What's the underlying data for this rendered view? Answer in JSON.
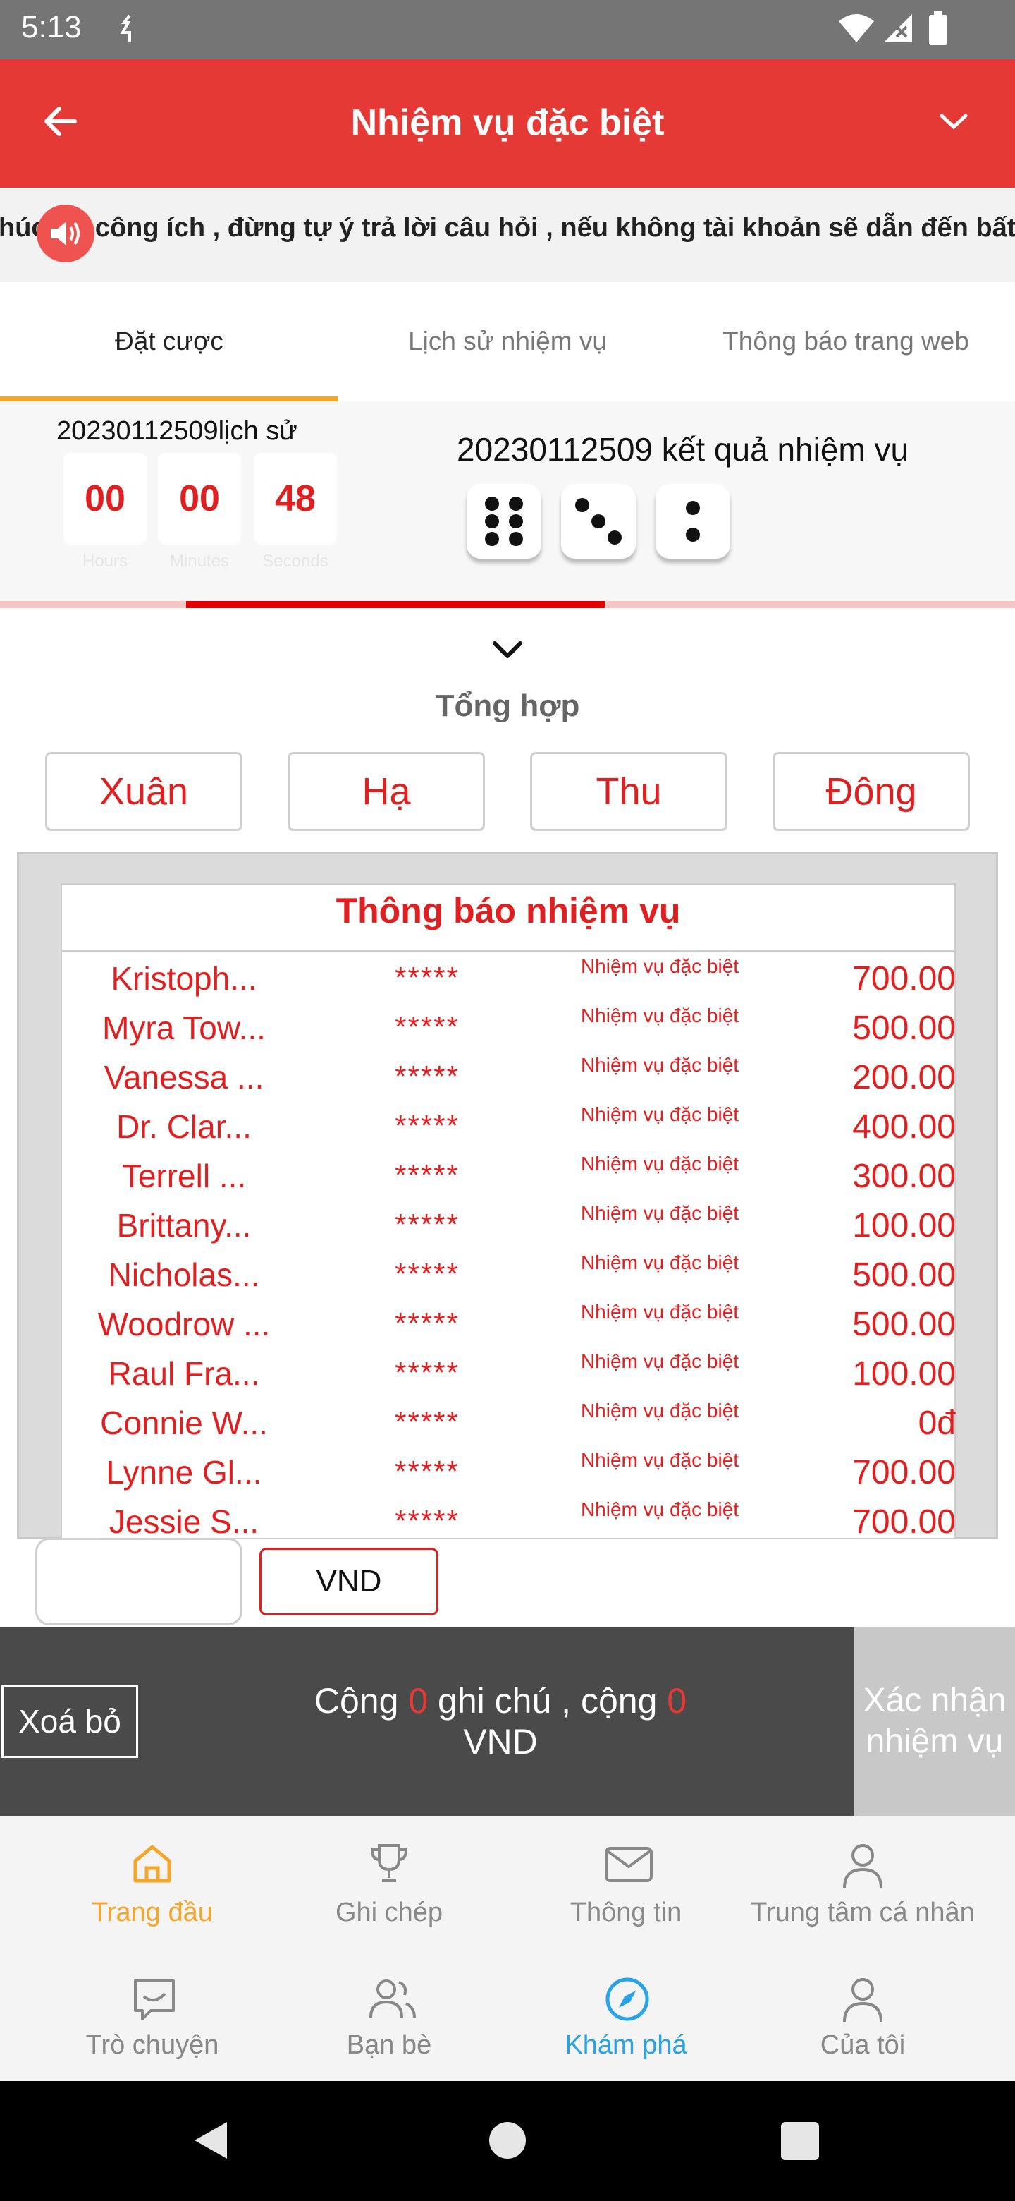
{
  "status_bar": {
    "time": "5:13"
  },
  "header": {
    "title": "Nhiệm vụ đặc biệt"
  },
  "marquee": {
    "text": "húc lời công ích , đừng tự ý trả lời câu hỏi , nếu không tài khoản sẽ dẫn đến bất"
  },
  "tabs": [
    {
      "label": "Đặt cược",
      "active": true
    },
    {
      "label": "Lịch sử nhiệm vụ",
      "active": false
    },
    {
      "label": "Thông báo trang web",
      "active": false
    }
  ],
  "round": {
    "issue_label": "20230112509lịch sử",
    "countdown": {
      "hours": "00",
      "minutes": "00",
      "seconds": "48",
      "hours_label": "Hours",
      "minutes_label": "Minutes",
      "seconds_label": "Seconds"
    },
    "result_label": "20230112509 kết quả nhiệm vụ",
    "dice": [
      6,
      3,
      2
    ],
    "progress": 0.41
  },
  "summary": {
    "label": "Tổng hợp"
  },
  "seasons": [
    "Xuân",
    "Hạ",
    "Thu",
    "Đông"
  ],
  "notice": {
    "title": "Thông báo nhiệm vụ",
    "rows": [
      {
        "name": "Kristoph...",
        "stars": "*****",
        "task": "Nhiệm vụ đặc biệt",
        "amount": "700.00"
      },
      {
        "name": "Myra Tow...",
        "stars": "*****",
        "task": "Nhiệm vụ đặc biệt",
        "amount": "500.00"
      },
      {
        "name": "Vanessa ...",
        "stars": "*****",
        "task": "Nhiệm vụ đặc biệt",
        "amount": "200.00"
      },
      {
        "name": "Dr. Clar...",
        "stars": "*****",
        "task": "Nhiệm vụ đặc biệt",
        "amount": "400.00"
      },
      {
        "name": "Terrell ...",
        "stars": "*****",
        "task": "Nhiệm vụ đặc biệt",
        "amount": "300.00"
      },
      {
        "name": "Brittany...",
        "stars": "*****",
        "task": "Nhiệm vụ đặc biệt",
        "amount": "100.00"
      },
      {
        "name": "Nicholas...",
        "stars": "*****",
        "task": "Nhiệm vụ đặc biệt",
        "amount": "500.00"
      },
      {
        "name": "Woodrow ...",
        "stars": "*****",
        "task": "Nhiệm vụ đặc biệt",
        "amount": "500.00"
      },
      {
        "name": "Raul Fra...",
        "stars": "*****",
        "task": "Nhiệm vụ đặc biệt",
        "amount": "100.00"
      },
      {
        "name": "Connie W...",
        "stars": "*****",
        "task": "Nhiệm vụ đặc biệt",
        "amount": "0đ"
      },
      {
        "name": "Lynne Gl...",
        "stars": "*****",
        "task": "Nhiệm vụ đặc biệt",
        "amount": "700.00"
      },
      {
        "name": "Jessie S...",
        "stars": "*****",
        "task": "Nhiệm vụ đặc biệt",
        "amount": "700.00"
      }
    ]
  },
  "entry": {
    "value": "",
    "currency_button": "VND"
  },
  "action_bar": {
    "clear_label": "Xoá bỏ",
    "totals_prefix": "Cộng",
    "notes_count": "0",
    "totals_mid": "ghi chú , cộng",
    "amount_total": "0",
    "currency": "VND",
    "confirm_label": "Xác nhận nhiệm vụ"
  },
  "inner_nav": [
    {
      "label": "Trang đầu",
      "icon": "home-icon",
      "active": true
    },
    {
      "label": "Ghi chép",
      "icon": "trophy-icon",
      "active": false
    },
    {
      "label": "Thông tin",
      "icon": "mail-icon",
      "active": false
    },
    {
      "label": "Trung tâm cá nhân",
      "icon": "user-icon",
      "active": false
    }
  ],
  "outer_nav": [
    {
      "label": "Trò chuyện",
      "icon": "chat-icon",
      "active": false
    },
    {
      "label": "Bạn bè",
      "icon": "friends-icon",
      "active": false
    },
    {
      "label": "Khám phá",
      "icon": "compass-icon",
      "active": true
    },
    {
      "label": "Của tôi",
      "icon": "profile-icon",
      "active": false
    }
  ],
  "colors": {
    "brand_red": "#e53935",
    "accent_orange": "#f4a52a",
    "accent_blue": "#29a3e8",
    "dark_bar": "#4a4a4a"
  }
}
